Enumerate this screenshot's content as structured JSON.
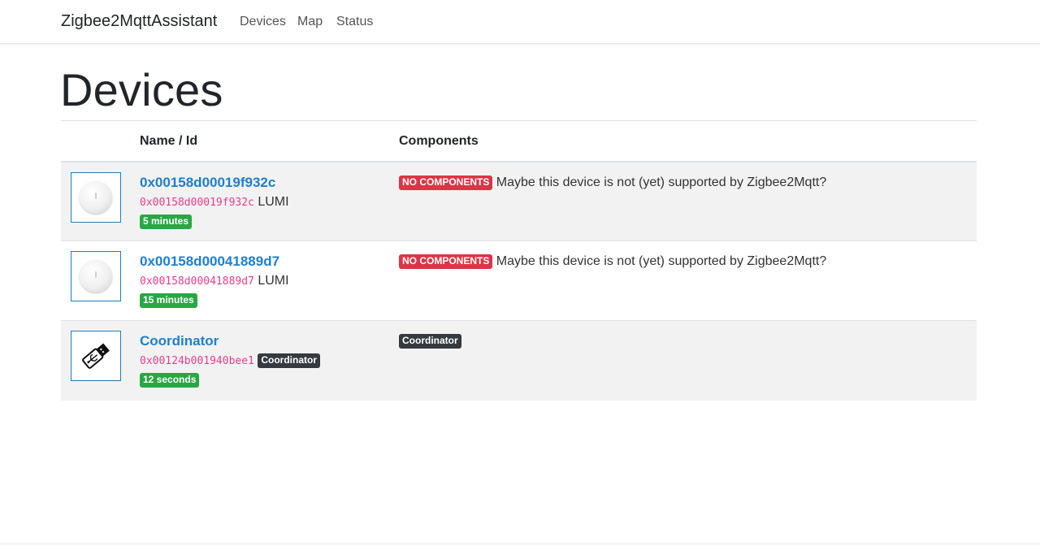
{
  "nav": {
    "brand": "Zigbee2MqttAssistant",
    "links": [
      "Devices",
      "Map",
      "Status"
    ]
  },
  "page": {
    "title": "Devices"
  },
  "table": {
    "headers": [
      "",
      "Name / Id",
      "Components"
    ],
    "rows": [
      {
        "icon": "round-sensor-icon",
        "name": "0x00158d00019f932c",
        "id": "0x00158d00019f932c",
        "vendor": "LUMI",
        "age": "5 minutes",
        "component_badge": "No components",
        "component_text": "Maybe this device is not (yet) supported by Zigbee2Mqtt?"
      },
      {
        "icon": "round-sensor-icon",
        "name": "0x00158d00041889d7",
        "id": "0x00158d00041889d7",
        "vendor": "LUMI",
        "age": "15 minutes",
        "component_badge": "No components",
        "component_text": "Maybe this device is not (yet) supported by Zigbee2Mqtt?"
      },
      {
        "icon": "usb-stick-icon",
        "name": "Coordinator",
        "id": "0x00124b001940bee1",
        "type_badge": "Coordinator",
        "age": "12 seconds",
        "component_badge": "Coordinator"
      }
    ]
  },
  "colors": {
    "link": "#1e7fcf",
    "success": "#28a745",
    "danger": "#dc3545",
    "dark": "#343a40",
    "code": "#e83e8c"
  }
}
